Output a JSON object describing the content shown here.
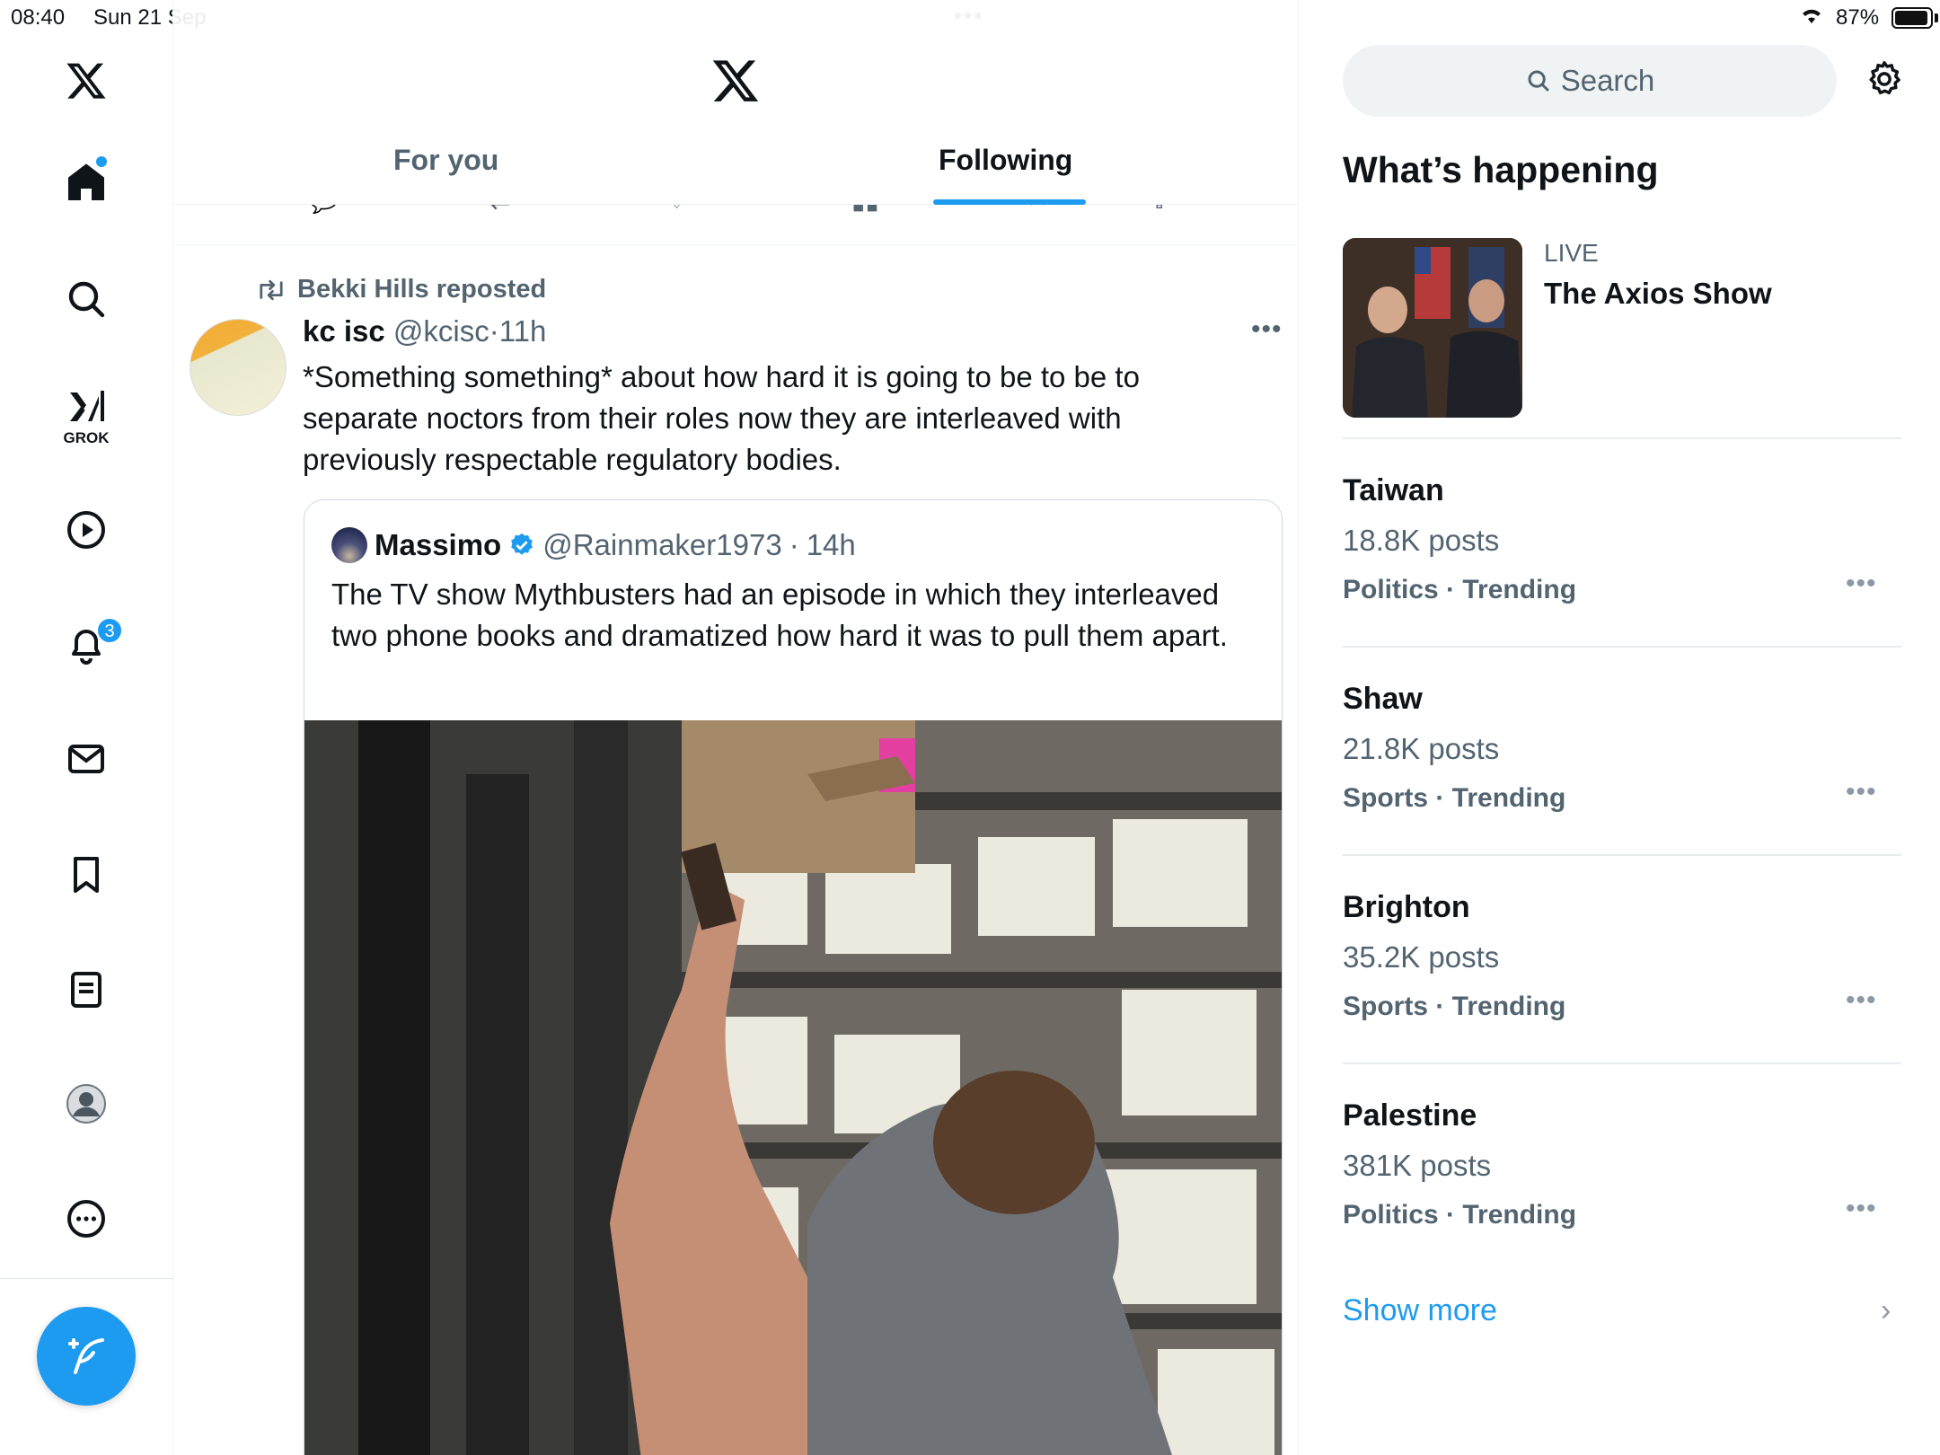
{
  "status": {
    "time": "08:40",
    "date": "Sun 21 Sep",
    "battery": "87%",
    "battery_level": 0.87
  },
  "nav": {
    "items": [
      "home",
      "explore",
      "grok",
      "video",
      "notifications",
      "messages",
      "bookmarks",
      "lists",
      "profile",
      "more"
    ],
    "grok_label": "GROK",
    "notification_count": "3"
  },
  "header": {
    "tabs": [
      {
        "label": "For you",
        "active": false
      },
      {
        "label": "Following",
        "active": true
      }
    ]
  },
  "tweet": {
    "repost_label": "Bekki Hills reposted",
    "name": "kc isc",
    "handle": "@kcisc",
    "separator": "·",
    "time": "11h",
    "text": "*Something something* about how hard it is going to be to be to separate noctors from their roles now they are interleaved with previously respectable regulatory bodies.",
    "quote": {
      "name": "Massimo",
      "verified": true,
      "handle": "@Rainmaker1973",
      "time": "14h",
      "text": "The TV show Mythbusters had an episode in which they interleaved two phone books and dramatized how hard it was to pull them apart."
    }
  },
  "sidebar": {
    "search_placeholder": "Search",
    "section_title": "What’s happening",
    "live": {
      "label": "LIVE",
      "title": "The Axios Show"
    },
    "trends": [
      {
        "name": "Taiwan",
        "posts": "18.8K posts",
        "category": "Politics · Trending"
      },
      {
        "name": "Shaw",
        "posts": "21.8K posts",
        "category": "Sports · Trending"
      },
      {
        "name": "Brighton",
        "posts": "35.2K posts",
        "category": "Sports · Trending"
      },
      {
        "name": "Palestine",
        "posts": "381K posts",
        "category": "Politics · Trending"
      }
    ],
    "show_more": "Show more"
  },
  "colors": {
    "accent": "#1d9bf0",
    "text": "#0f1419",
    "muted": "#536471",
    "border": "#eff3f4"
  }
}
